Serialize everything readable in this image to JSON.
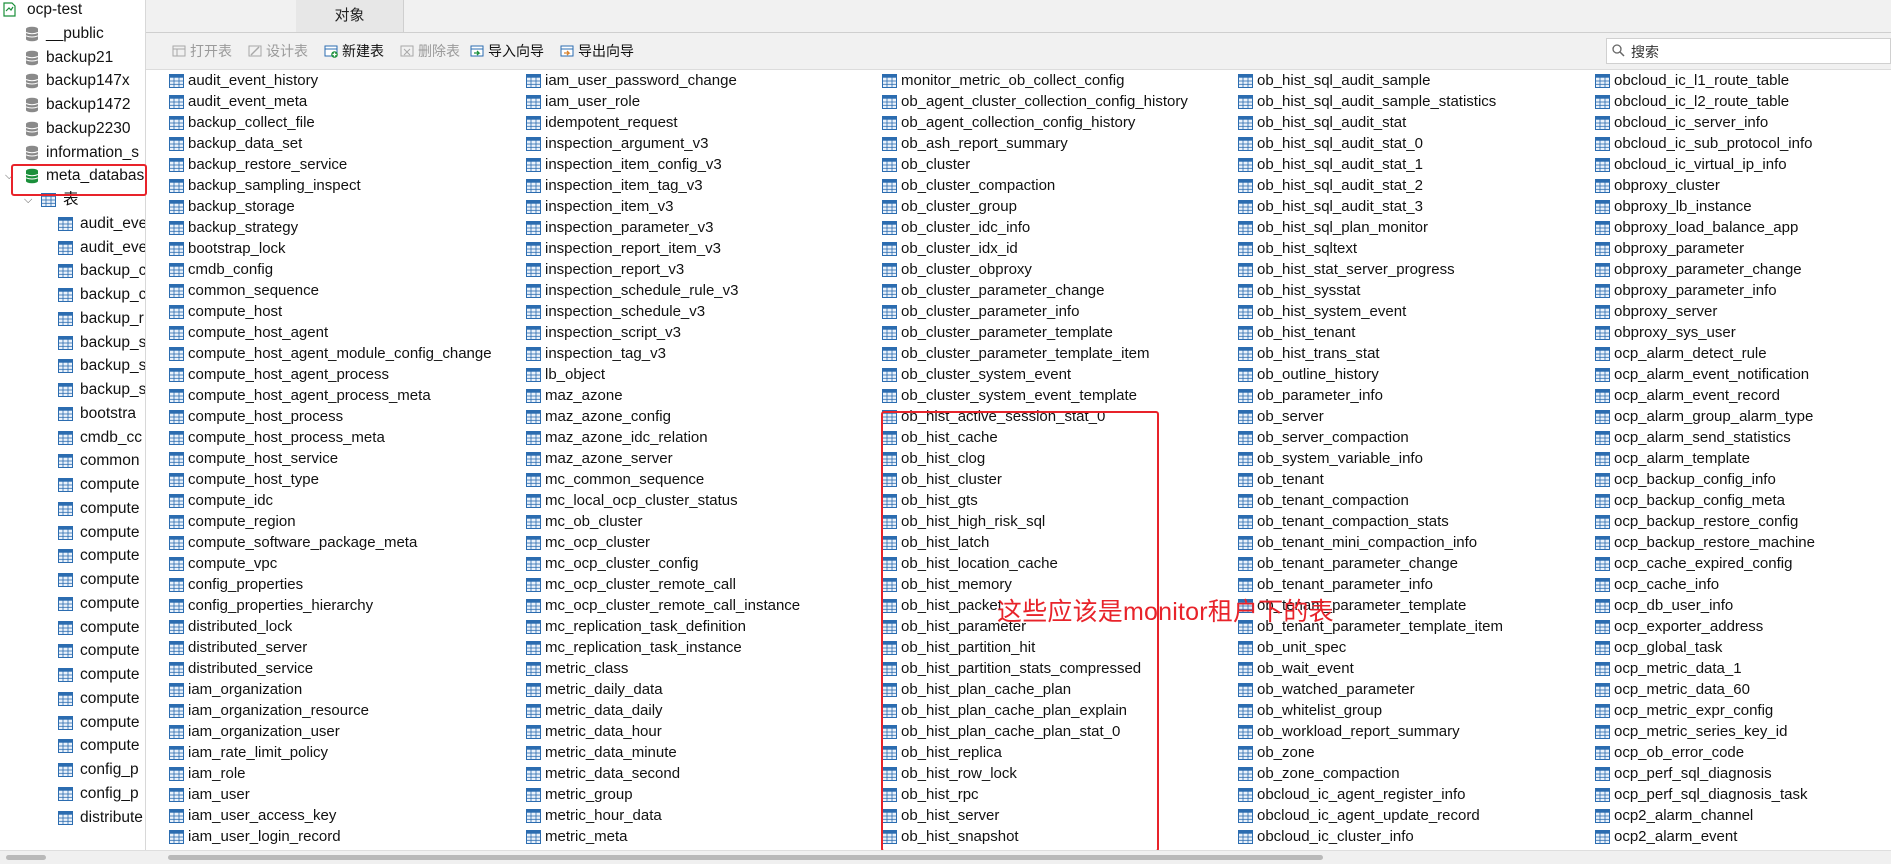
{
  "sidebar": {
    "connection": "ocp-test",
    "databases": [
      "__public",
      "backup21",
      "backup147x",
      "backup1472",
      "backup2230",
      "information_s",
      "meta_databas"
    ],
    "selected_database": "meta_databas",
    "tables_folder": "表",
    "tables": [
      "audit_eve",
      "audit_eve",
      "backup_c",
      "backup_c",
      "backup_r",
      "backup_s",
      "backup_s",
      "backup_s",
      "bootstra",
      "cmdb_cc",
      "common",
      "compute",
      "compute",
      "compute",
      "compute",
      "compute",
      "compute",
      "compute",
      "compute",
      "compute",
      "compute",
      "compute",
      "compute",
      "config_p",
      "config_p",
      "distribute"
    ]
  },
  "tab": {
    "label": "对象"
  },
  "toolbar": {
    "open": "打开表",
    "design": "设计表",
    "new": "新建表",
    "delete": "删除表",
    "import": "导入向导",
    "export": "导出向导"
  },
  "search": {
    "placeholder": "搜索"
  },
  "annotation": "这些应该是monitor租户下的表",
  "colors": {
    "highlight": "#e8232a",
    "db_icon": "#1a8f3a",
    "table_icon": "#2b6cb0"
  },
  "columns": [
    [
      "audit_event_history",
      "audit_event_meta",
      "backup_collect_file",
      "backup_data_set",
      "backup_restore_service",
      "backup_sampling_inspect",
      "backup_storage",
      "backup_strategy",
      "bootstrap_lock",
      "cmdb_config",
      "common_sequence",
      "compute_host",
      "compute_host_agent",
      "compute_host_agent_module_config_change",
      "compute_host_agent_process",
      "compute_host_agent_process_meta",
      "compute_host_process",
      "compute_host_process_meta",
      "compute_host_service",
      "compute_host_type",
      "compute_idc",
      "compute_region",
      "compute_software_package_meta",
      "compute_vpc",
      "config_properties",
      "config_properties_hierarchy",
      "distributed_lock",
      "distributed_server",
      "distributed_service",
      "iam_organization",
      "iam_organization_resource",
      "iam_organization_user",
      "iam_rate_limit_policy",
      "iam_role",
      "iam_user",
      "iam_user_access_key",
      "iam_user_login_record"
    ],
    [
      "iam_user_password_change",
      "iam_user_role",
      "idempotent_request",
      "inspection_argument_v3",
      "inspection_item_config_v3",
      "inspection_item_tag_v3",
      "inspection_item_v3",
      "inspection_parameter_v3",
      "inspection_report_item_v3",
      "inspection_report_v3",
      "inspection_schedule_rule_v3",
      "inspection_schedule_v3",
      "inspection_script_v3",
      "inspection_tag_v3",
      "lb_object",
      "maz_azone",
      "maz_azone_config",
      "maz_azone_idc_relation",
      "maz_azone_server",
      "mc_common_sequence",
      "mc_local_ocp_cluster_status",
      "mc_ob_cluster",
      "mc_ocp_cluster",
      "mc_ocp_cluster_config",
      "mc_ocp_cluster_remote_call",
      "mc_ocp_cluster_remote_call_instance",
      "mc_replication_task_definition",
      "mc_replication_task_instance",
      "metric_class",
      "metric_daily_data",
      "metric_data_daily",
      "metric_data_hour",
      "metric_data_minute",
      "metric_data_second",
      "metric_group",
      "metric_hour_data",
      "metric_meta"
    ],
    [
      "monitor_metric_ob_collect_config",
      "ob_agent_cluster_collection_config_history",
      "ob_agent_collection_config_history",
      "ob_ash_report_summary",
      "ob_cluster",
      "ob_cluster_compaction",
      "ob_cluster_group",
      "ob_cluster_idc_info",
      "ob_cluster_idx_id",
      "ob_cluster_obproxy",
      "ob_cluster_parameter_change",
      "ob_cluster_parameter_info",
      "ob_cluster_parameter_template",
      "ob_cluster_parameter_template_item",
      "ob_cluster_system_event",
      "ob_cluster_system_event_template",
      "ob_hist_active_session_stat_0",
      "ob_hist_cache",
      "ob_hist_clog",
      "ob_hist_cluster",
      "ob_hist_gts",
      "ob_hist_high_risk_sql",
      "ob_hist_latch",
      "ob_hist_location_cache",
      "ob_hist_memory",
      "ob_hist_packet",
      "ob_hist_parameter",
      "ob_hist_partition_hit",
      "ob_hist_partition_stats_compressed",
      "ob_hist_plan_cache_plan",
      "ob_hist_plan_cache_plan_explain",
      "ob_hist_plan_cache_plan_stat_0",
      "ob_hist_replica",
      "ob_hist_row_lock",
      "ob_hist_rpc",
      "ob_hist_server",
      "ob_hist_snapshot"
    ],
    [
      "ob_hist_sql_audit_sample",
      "ob_hist_sql_audit_sample_statistics",
      "ob_hist_sql_audit_stat",
      "ob_hist_sql_audit_stat_0",
      "ob_hist_sql_audit_stat_1",
      "ob_hist_sql_audit_stat_2",
      "ob_hist_sql_audit_stat_3",
      "ob_hist_sql_plan_monitor",
      "ob_hist_sqltext",
      "ob_hist_stat_server_progress",
      "ob_hist_sysstat",
      "ob_hist_system_event",
      "ob_hist_tenant",
      "ob_hist_trans_stat",
      "ob_outline_history",
      "ob_parameter_info",
      "ob_server",
      "ob_server_compaction",
      "ob_system_variable_info",
      "ob_tenant",
      "ob_tenant_compaction",
      "ob_tenant_compaction_stats",
      "ob_tenant_mini_compaction_info",
      "ob_tenant_parameter_change",
      "ob_tenant_parameter_info",
      "ob_tenant_parameter_template",
      "ob_tenant_parameter_template_item",
      "ob_unit_spec",
      "ob_wait_event",
      "ob_watched_parameter",
      "ob_whitelist_group",
      "ob_workload_report_summary",
      "ob_zone",
      "ob_zone_compaction",
      "obcloud_ic_agent_register_info",
      "obcloud_ic_agent_update_record",
      "obcloud_ic_cluster_info"
    ],
    [
      "obcloud_ic_l1_route_table",
      "obcloud_ic_l2_route_table",
      "obcloud_ic_server_info",
      "obcloud_ic_sub_protocol_info",
      "obcloud_ic_virtual_ip_info",
      "obproxy_cluster",
      "obproxy_lb_instance",
      "obproxy_load_balance_app",
      "obproxy_parameter",
      "obproxy_parameter_change",
      "obproxy_parameter_info",
      "obproxy_server",
      "obproxy_sys_user",
      "ocp_alarm_detect_rule",
      "ocp_alarm_event_notification",
      "ocp_alarm_event_record",
      "ocp_alarm_group_alarm_type",
      "ocp_alarm_send_statistics",
      "ocp_alarm_template",
      "ocp_backup_config_info",
      "ocp_backup_config_meta",
      "ocp_backup_restore_config",
      "ocp_backup_restore_machine",
      "ocp_cache_expired_config",
      "ocp_cache_info",
      "ocp_db_user_info",
      "ocp_exporter_address",
      "ocp_global_task",
      "ocp_metric_data_1",
      "ocp_metric_data_60",
      "ocp_metric_expr_config",
      "ocp_metric_series_key_id",
      "ocp_ob_error_code",
      "ocp_perf_sql_diagnosis",
      "ocp_perf_sql_diagnosis_task",
      "ocp2_alarm_channel",
      "ocp2_alarm_event"
    ]
  ]
}
